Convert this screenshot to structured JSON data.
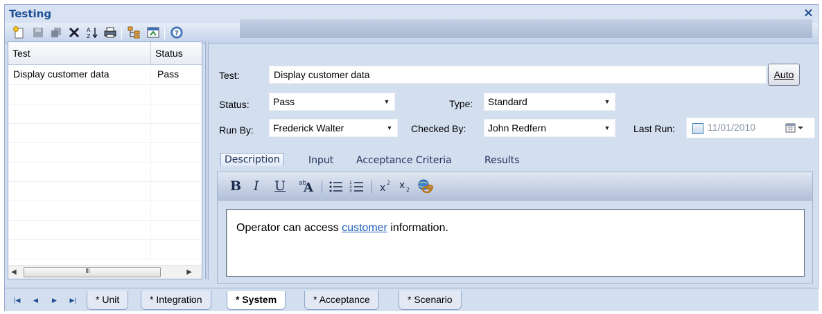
{
  "window": {
    "title": "Testing",
    "close_glyph": "×"
  },
  "toolbar": {
    "icons": [
      "new-test-icon",
      "save-icon",
      "copy-icon",
      "delete-icon",
      "sort-icon",
      "print-icon",
      "hierarchy-icon",
      "import-icon",
      "help-icon"
    ]
  },
  "grid": {
    "columns": [
      "Test",
      "Status"
    ],
    "rows": [
      {
        "test": "Display customer data",
        "status": "Pass"
      }
    ],
    "scroll_grip": "III"
  },
  "form": {
    "test_label": "Test:",
    "test_value": "Display customer data",
    "auto_label": "Auto",
    "status_label": "Status:",
    "status_value": "Pass",
    "type_label": "Type:",
    "type_value": "Standard",
    "runby_label": "Run By:",
    "runby_value": "Frederick Walter",
    "checkedby_label": "Checked By:",
    "checkedby_value": "John Redfern",
    "lastrun_label": "Last Run:",
    "lastrun_value": "11/01/2010"
  },
  "tabs": [
    "Description",
    "Input",
    "Acceptance Criteria",
    "Results"
  ],
  "rte": {
    "bold": "B",
    "italic": "I",
    "underline": "U"
  },
  "editor": {
    "before": "Operator can access ",
    "link": "customer",
    "after": " information."
  },
  "bottom_tabs": [
    "* Unit",
    "* Integration",
    "* System",
    "* Acceptance",
    "* Scenario"
  ],
  "colors": {
    "title": "#1c4e94",
    "panel": "#d3deef",
    "link": "#1f5fbf"
  }
}
